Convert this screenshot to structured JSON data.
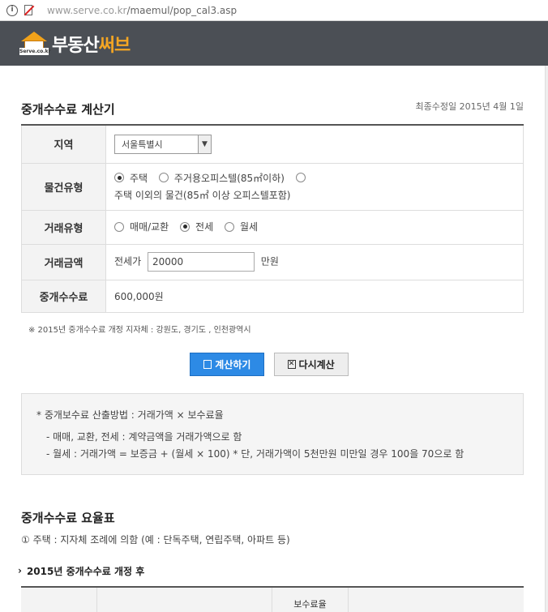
{
  "browser": {
    "url_host": "www.serve.co.kr",
    "url_path": "/maemul/pop_cal3.asp"
  },
  "header": {
    "logo_tag": "Serve.co.kr",
    "logo_text_main": "부동산",
    "logo_text_accent": "써브"
  },
  "page": {
    "title": "중개수수료 계산기",
    "updated": "최종수정일 2015년 4월 1일"
  },
  "form": {
    "region_label": "지역",
    "region_value": "서울특별시",
    "property_label": "물건유형",
    "property_options": [
      "주택",
      "주거용오피스텔(85㎡이하)",
      "주택 이외의 물건(85㎡ 이상 오피스텔포함)"
    ],
    "deal_label": "거래유형",
    "deal_options": [
      "매매/교환",
      "전세",
      "월세"
    ],
    "amount_label": "거래금액",
    "amount_prefix": "전세가",
    "amount_value": "20000",
    "amount_unit": "만원",
    "fee_label": "중개수수료",
    "fee_value": "600,000원"
  },
  "note": "※ 2015년 중개수수료 개정 지자체 : 강원도, 경기도 , 인천광역시",
  "buttons": {
    "calculate": "계산하기",
    "reset": "다시계산"
  },
  "info": {
    "main": "* 중개보수료 산출방법 : 거래가액 × 보수료율",
    "line1": "- 매매, 교환, 전세 : 계약금액을 거래가액으로 함",
    "line2": "- 월세 : 거래가액 = 보증금 + (월세 × 100) * 단, 거래가액이 5천만원 미만일 경우 100을 70으로 함"
  },
  "rates": {
    "title": "중개수수료 요율표",
    "note": "① 주택 : 지자체 조례에 의함 (예 : 단독주택, 연립주택, 아파트 등)",
    "subtitle": "2015년 중개수수료 개정 후",
    "partial_header": "보수료율"
  }
}
